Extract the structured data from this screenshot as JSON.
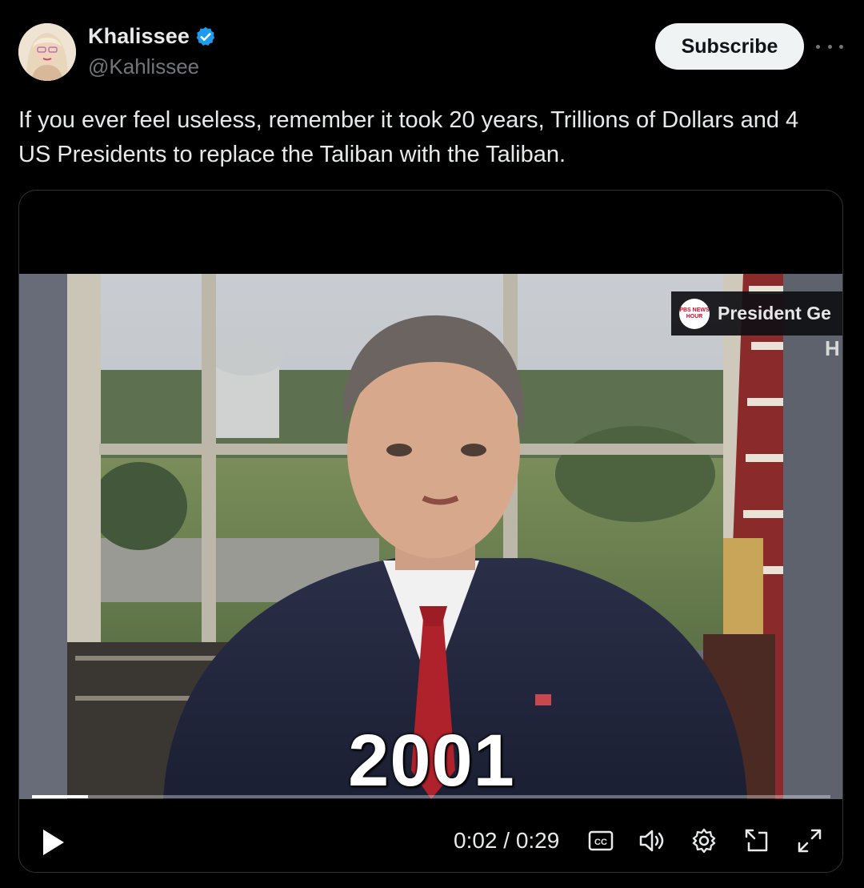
{
  "author": {
    "display_name": "Khalissee",
    "handle": "@Kahlissee",
    "verified": true,
    "verified_color": "#1d9bf0",
    "avatar_icon": "profile-photo"
  },
  "header": {
    "subscribe_label": "Subscribe",
    "more_icon": "more-horizontal-icon"
  },
  "post": {
    "text": "If you ever feel useless, remember it took 20 years, Trillions of Dollars and 4 US Presidents to replace the Taliban with the Taliban."
  },
  "video": {
    "overlay_channel": "PBS NEWS HOUR",
    "overlay_title": "President Ge",
    "overlay_subtitle": "H",
    "caption_year": "2001",
    "progress_fraction": 0.07,
    "time": "0:02 / 0:29",
    "controls": {
      "play_icon": "play-icon",
      "cc_icon": "closed-captions-icon",
      "volume_icon": "volume-icon",
      "settings_icon": "gear-icon",
      "pip_icon": "picture-in-picture-icon",
      "fullscreen_icon": "fullscreen-icon"
    }
  }
}
